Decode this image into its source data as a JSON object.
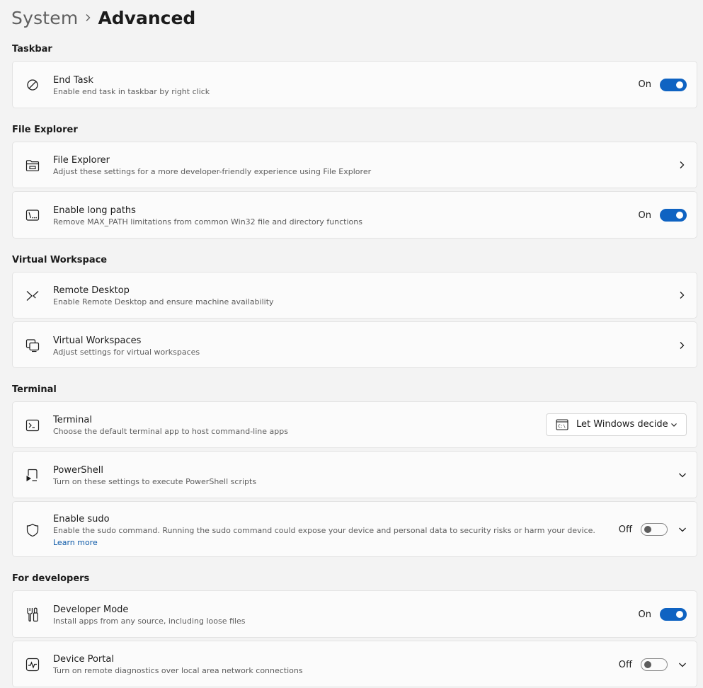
{
  "breadcrumb": {
    "parent": "System",
    "current": "Advanced"
  },
  "colors": {
    "accent": "#0f63c2",
    "background": "#f3f3f3",
    "card": "#fbfbfb"
  },
  "sections": {
    "taskbar": {
      "title": "Taskbar",
      "end_task": {
        "title": "End Task",
        "desc": "Enable end task in taskbar by right click",
        "state": "On",
        "icon": "block-icon"
      }
    },
    "file_explorer": {
      "title": "File Explorer",
      "file_explorer": {
        "title": "File Explorer",
        "desc": "Adjust these settings for a more developer-friendly experience using File Explorer",
        "icon": "folder-icon"
      },
      "long_paths": {
        "title": "Enable long paths",
        "desc": "Remove MAX_PATH limitations from common Win32 file and directory functions",
        "state": "On",
        "icon": "path-icon"
      }
    },
    "virtual_workspace": {
      "title": "Virtual Workspace",
      "remote_desktop": {
        "title": "Remote Desktop",
        "desc": "Enable Remote Desktop and ensure machine availability",
        "icon": "remote-desktop-icon"
      },
      "virtual_workspaces": {
        "title": "Virtual Workspaces",
        "desc": "Adjust settings for virtual workspaces",
        "icon": "virtual-workspaces-icon"
      }
    },
    "terminal": {
      "title": "Terminal",
      "terminal": {
        "title": "Terminal",
        "desc": "Choose the default terminal app to host command-line apps",
        "dropdown_value": "Let Windows decide",
        "icon": "terminal-icon"
      },
      "powershell": {
        "title": "PowerShell",
        "desc": "Turn on these settings to execute PowerShell scripts",
        "icon": "powershell-icon"
      },
      "sudo": {
        "title": "Enable sudo",
        "desc": "Enable the sudo command. Running the sudo command could expose your device and personal data to security risks or harm your device.",
        "link": "Learn more",
        "state": "Off",
        "icon": "shield-icon"
      }
    },
    "developers": {
      "title": "For developers",
      "developer_mode": {
        "title": "Developer Mode",
        "desc": "Install apps from any source, including loose files",
        "state": "On",
        "icon": "developer-tools-icon"
      },
      "device_portal": {
        "title": "Device Portal",
        "desc": "Turn on remote diagnostics over local area network connections",
        "state": "Off",
        "icon": "pulse-icon"
      }
    }
  }
}
